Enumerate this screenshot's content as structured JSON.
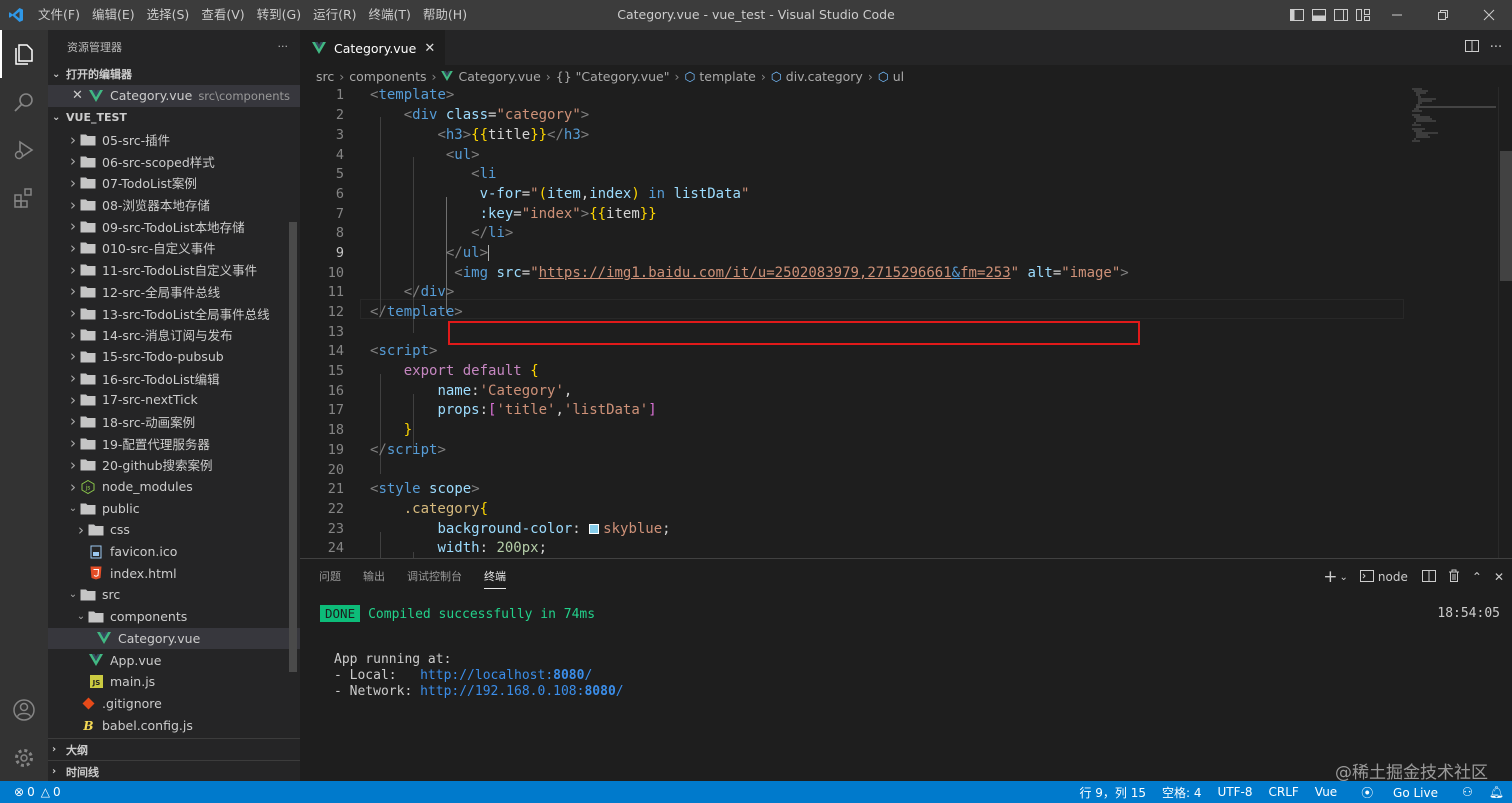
{
  "titlebar": {
    "title": "Category.vue - vue_test - Visual Studio Code",
    "menu": [
      "文件(F)",
      "编辑(E)",
      "选择(S)",
      "查看(V)",
      "转到(G)",
      "运行(R)",
      "终端(T)",
      "帮助(H)"
    ]
  },
  "activity": [
    "explorer-icon",
    "search-icon",
    "run-debug-icon",
    "extensions-icon",
    "account-icon",
    "settings-gear-icon"
  ],
  "sidebar": {
    "header": "资源管理器",
    "more": "···",
    "open_editors_title": "打开的编辑器",
    "open_editor": {
      "name": "Category.vue",
      "path": "src\\components"
    },
    "project_title": "VUE_TEST",
    "tree": [
      {
        "name": "05-src-插件",
        "type": "folder",
        "depth": 1
      },
      {
        "name": "06-src-scoped样式",
        "type": "folder",
        "depth": 1
      },
      {
        "name": "07-TodoList案例",
        "type": "folder",
        "depth": 1
      },
      {
        "name": "08-浏览器本地存储",
        "type": "folder",
        "depth": 1
      },
      {
        "name": "09-src-TodoList本地存储",
        "type": "folder",
        "depth": 1
      },
      {
        "name": "010-src-自定义事件",
        "type": "folder",
        "depth": 1
      },
      {
        "name": "11-src-TodoList自定义事件",
        "type": "folder",
        "depth": 1
      },
      {
        "name": "12-src-全局事件总线",
        "type": "folder",
        "depth": 1
      },
      {
        "name": "13-src-TodoList全局事件总线",
        "type": "folder",
        "depth": 1
      },
      {
        "name": "14-src-消息订阅与发布",
        "type": "folder",
        "depth": 1
      },
      {
        "name": "15-src-Todo-pubsub",
        "type": "folder",
        "depth": 1
      },
      {
        "name": "16-src-TodoList编辑",
        "type": "folder",
        "depth": 1
      },
      {
        "name": "17-src-nextTick",
        "type": "folder",
        "depth": 1
      },
      {
        "name": "18-src-动画案例",
        "type": "folder",
        "depth": 1
      },
      {
        "name": "19-配置代理服务器",
        "type": "folder",
        "depth": 1
      },
      {
        "name": "20-github搜索案例",
        "type": "folder",
        "depth": 1
      },
      {
        "name": "node_modules",
        "type": "node",
        "depth": 1
      },
      {
        "name": "public",
        "type": "folder-open",
        "depth": 1
      },
      {
        "name": "css",
        "type": "folder",
        "depth": 2
      },
      {
        "name": "favicon.ico",
        "type": "ico",
        "depth": 2
      },
      {
        "name": "index.html",
        "type": "html",
        "depth": 2
      },
      {
        "name": "src",
        "type": "folder-open",
        "depth": 1
      },
      {
        "name": "components",
        "type": "folder-open",
        "depth": 2
      },
      {
        "name": "Category.vue",
        "type": "vue",
        "depth": 3,
        "selected": true
      },
      {
        "name": "App.vue",
        "type": "vue",
        "depth": 2
      },
      {
        "name": "main.js",
        "type": "js",
        "depth": 2
      },
      {
        "name": ".gitignore",
        "type": "git",
        "depth": 1
      },
      {
        "name": "babel.config.js",
        "type": "babel",
        "depth": 1
      }
    ],
    "outline_title": "大纲",
    "timeline_title": "时间线"
  },
  "editor": {
    "tab_label": "Category.vue",
    "breadcrumb": [
      "src",
      "components",
      "Category.vue",
      "{} \"Category.vue\"",
      "template",
      "div.category",
      "ul"
    ],
    "line_numbers": [
      "1",
      "2",
      "3",
      "4",
      "5",
      "6",
      "7",
      "8",
      "9",
      "10",
      "11",
      "12",
      "13",
      "14",
      "15",
      "16",
      "17",
      "18",
      "19",
      "20",
      "21",
      "22",
      "23",
      "24"
    ],
    "code": {
      "l1_tag": "template",
      "l2_tag": "div",
      "l2_attr": "class",
      "l2_val": "\"category\"",
      "l3_tag": "h3",
      "l3_mid": "title",
      "l4_tag": "ul",
      "l5_tag": "li",
      "l6_attr": "v-for",
      "l6_q1": "\"",
      "l6_item": "item",
      "l6_index": "index",
      "l6_in": "in",
      "l6_list": "listData",
      "l6_q2": "\"",
      "l7_attr": ":key",
      "l7_val": "\"index\"",
      "l7_item": "item",
      "l8_tag": "li",
      "l9_tag": "ul",
      "l10_tag": "img",
      "l10_src_attr": "src",
      "l10_url": "https://img1.baidu.com/it/u=2502083979,2715296661",
      "l10_amp": "&",
      "l10_url2": "fm=253",
      "l10_alt_attr": "alt",
      "l10_alt_val": "\"image\"",
      "l11_tag": "div",
      "l12_tag": "template",
      "l14_tag": "script",
      "l15_export": "export",
      "l15_default": "default",
      "l16_key": "name",
      "l16_val": "'Category'",
      "l17_key": "props",
      "l17_v1": "'title'",
      "l17_v2": "'listData'",
      "l19_tag": "script",
      "l21_tag": "style",
      "l21_attr": "scope",
      "l22_sel": ".category",
      "l23_prop": "background-color",
      "l23_val": "skyblue",
      "l24_prop": "width",
      "l24_val": "200px"
    }
  },
  "panel": {
    "tabs": [
      "问题",
      "输出",
      "调试控制台",
      "终端"
    ],
    "active_tab": "终端",
    "terminal_name": "node",
    "done_badge": "DONE",
    "compiled": "Compiled successfully in 74ms",
    "time": "18:54:05",
    "running": "App running at:",
    "local_label": "- Local:   ",
    "local_url": "http://localhost:",
    "local_port": "8080",
    "network_label": "- Network: ",
    "network_url": "http://192.168.0.108:",
    "network_port": "8080"
  },
  "status": {
    "errors": "0",
    "warnings": "0",
    "position": "行 9，列 15",
    "spaces": "空格: 4",
    "encoding": "UTF-8",
    "eol": "CRLF",
    "language": "Vue",
    "golive": "Go Live"
  },
  "watermark": "@稀土掘金技术社区",
  "colors": {
    "accent": "#007acc",
    "highlight_box": "#e01a1a",
    "skyblue": "#87ceeb"
  }
}
